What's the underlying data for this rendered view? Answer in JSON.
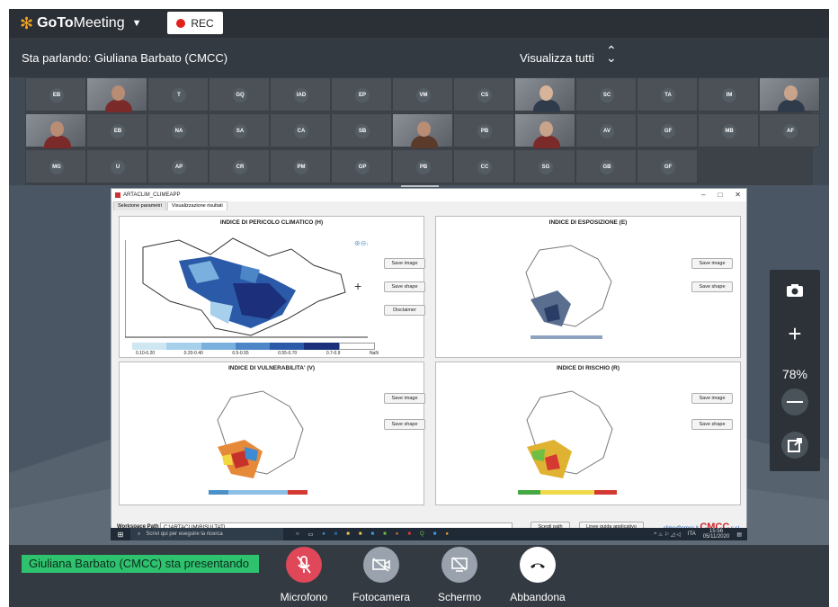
{
  "topbar": {
    "logo_brand": "GoTo",
    "logo_product": "Meeting",
    "logo_caret": "▼",
    "rec_label": "REC"
  },
  "speaker_bar": {
    "speaking": "Sta parlando: Giuliana Barbato (CMCC)",
    "view_all": "Visualizza tutti"
  },
  "participants": {
    "row1": [
      "EB",
      "video",
      "T",
      "GQ",
      "IAD",
      "EP",
      "VM",
      "CS",
      "video",
      "SC",
      "TA",
      "IM",
      "video"
    ],
    "row2": [
      "video",
      "EB",
      "NA",
      "SA",
      "CA",
      "SB",
      "video",
      "PB",
      "video",
      "AV",
      "GF",
      "MB",
      "AF"
    ],
    "row3": [
      "MG",
      "U",
      "AP",
      "CR",
      "PM",
      "GP",
      "PB",
      "CC",
      "SG",
      "GB",
      "GF"
    ]
  },
  "shared_app": {
    "title": "ARTACLIM_CLIMEAPP",
    "window_controls": [
      "–",
      "□",
      "✕"
    ],
    "tabs": [
      "Selezione parametri",
      "Visualizzazione risultati"
    ],
    "panels": [
      {
        "title": "INDICE DI PERICOLO CLIMATICO (H)",
        "buttons": [
          "Save image",
          "Save shape",
          "Disclaimer"
        ]
      },
      {
        "title": "INDICE DI ESPOSIZIONE (E)",
        "buttons": [
          "Save image",
          "Save shape"
        ]
      },
      {
        "title": "INDICE DI VULNERABILITA' (V)",
        "buttons": [
          "Save image",
          "Save shape"
        ]
      },
      {
        "title": "INDICE DI RISCHIO (R)",
        "buttons": [
          "Save image",
          "Save shape"
        ]
      }
    ],
    "legend_ticks": [
      "0.10-0.20",
      "0.20-0.40",
      "0.5-0.55",
      "0.55-0.70",
      "0.7-0.9",
      "NaN"
    ],
    "footer": {
      "workspace_label": "Workspace Path",
      "workspace_value": "C:\\ARTACLIM\\RISULTATI",
      "choose_path": "Scegli path",
      "guide": "Linee guida applicativo",
      "email": "clime@cmcc.it",
      "brand": "CMCC",
      "brand_suffix": "s.r.l."
    },
    "taskbar": {
      "search_placeholder": "Scrivi qui per eseguire la ricerca",
      "time": "15:56",
      "date": "05/11/2020",
      "lang": "ITA"
    }
  },
  "side_controls": {
    "zoom": "78%"
  },
  "bottom": {
    "presenting": "Giuliana Barbato (CMCC) sta presentando",
    "controls": [
      "Microfono",
      "Fotocamera",
      "Schermo",
      "Abbandona"
    ]
  }
}
